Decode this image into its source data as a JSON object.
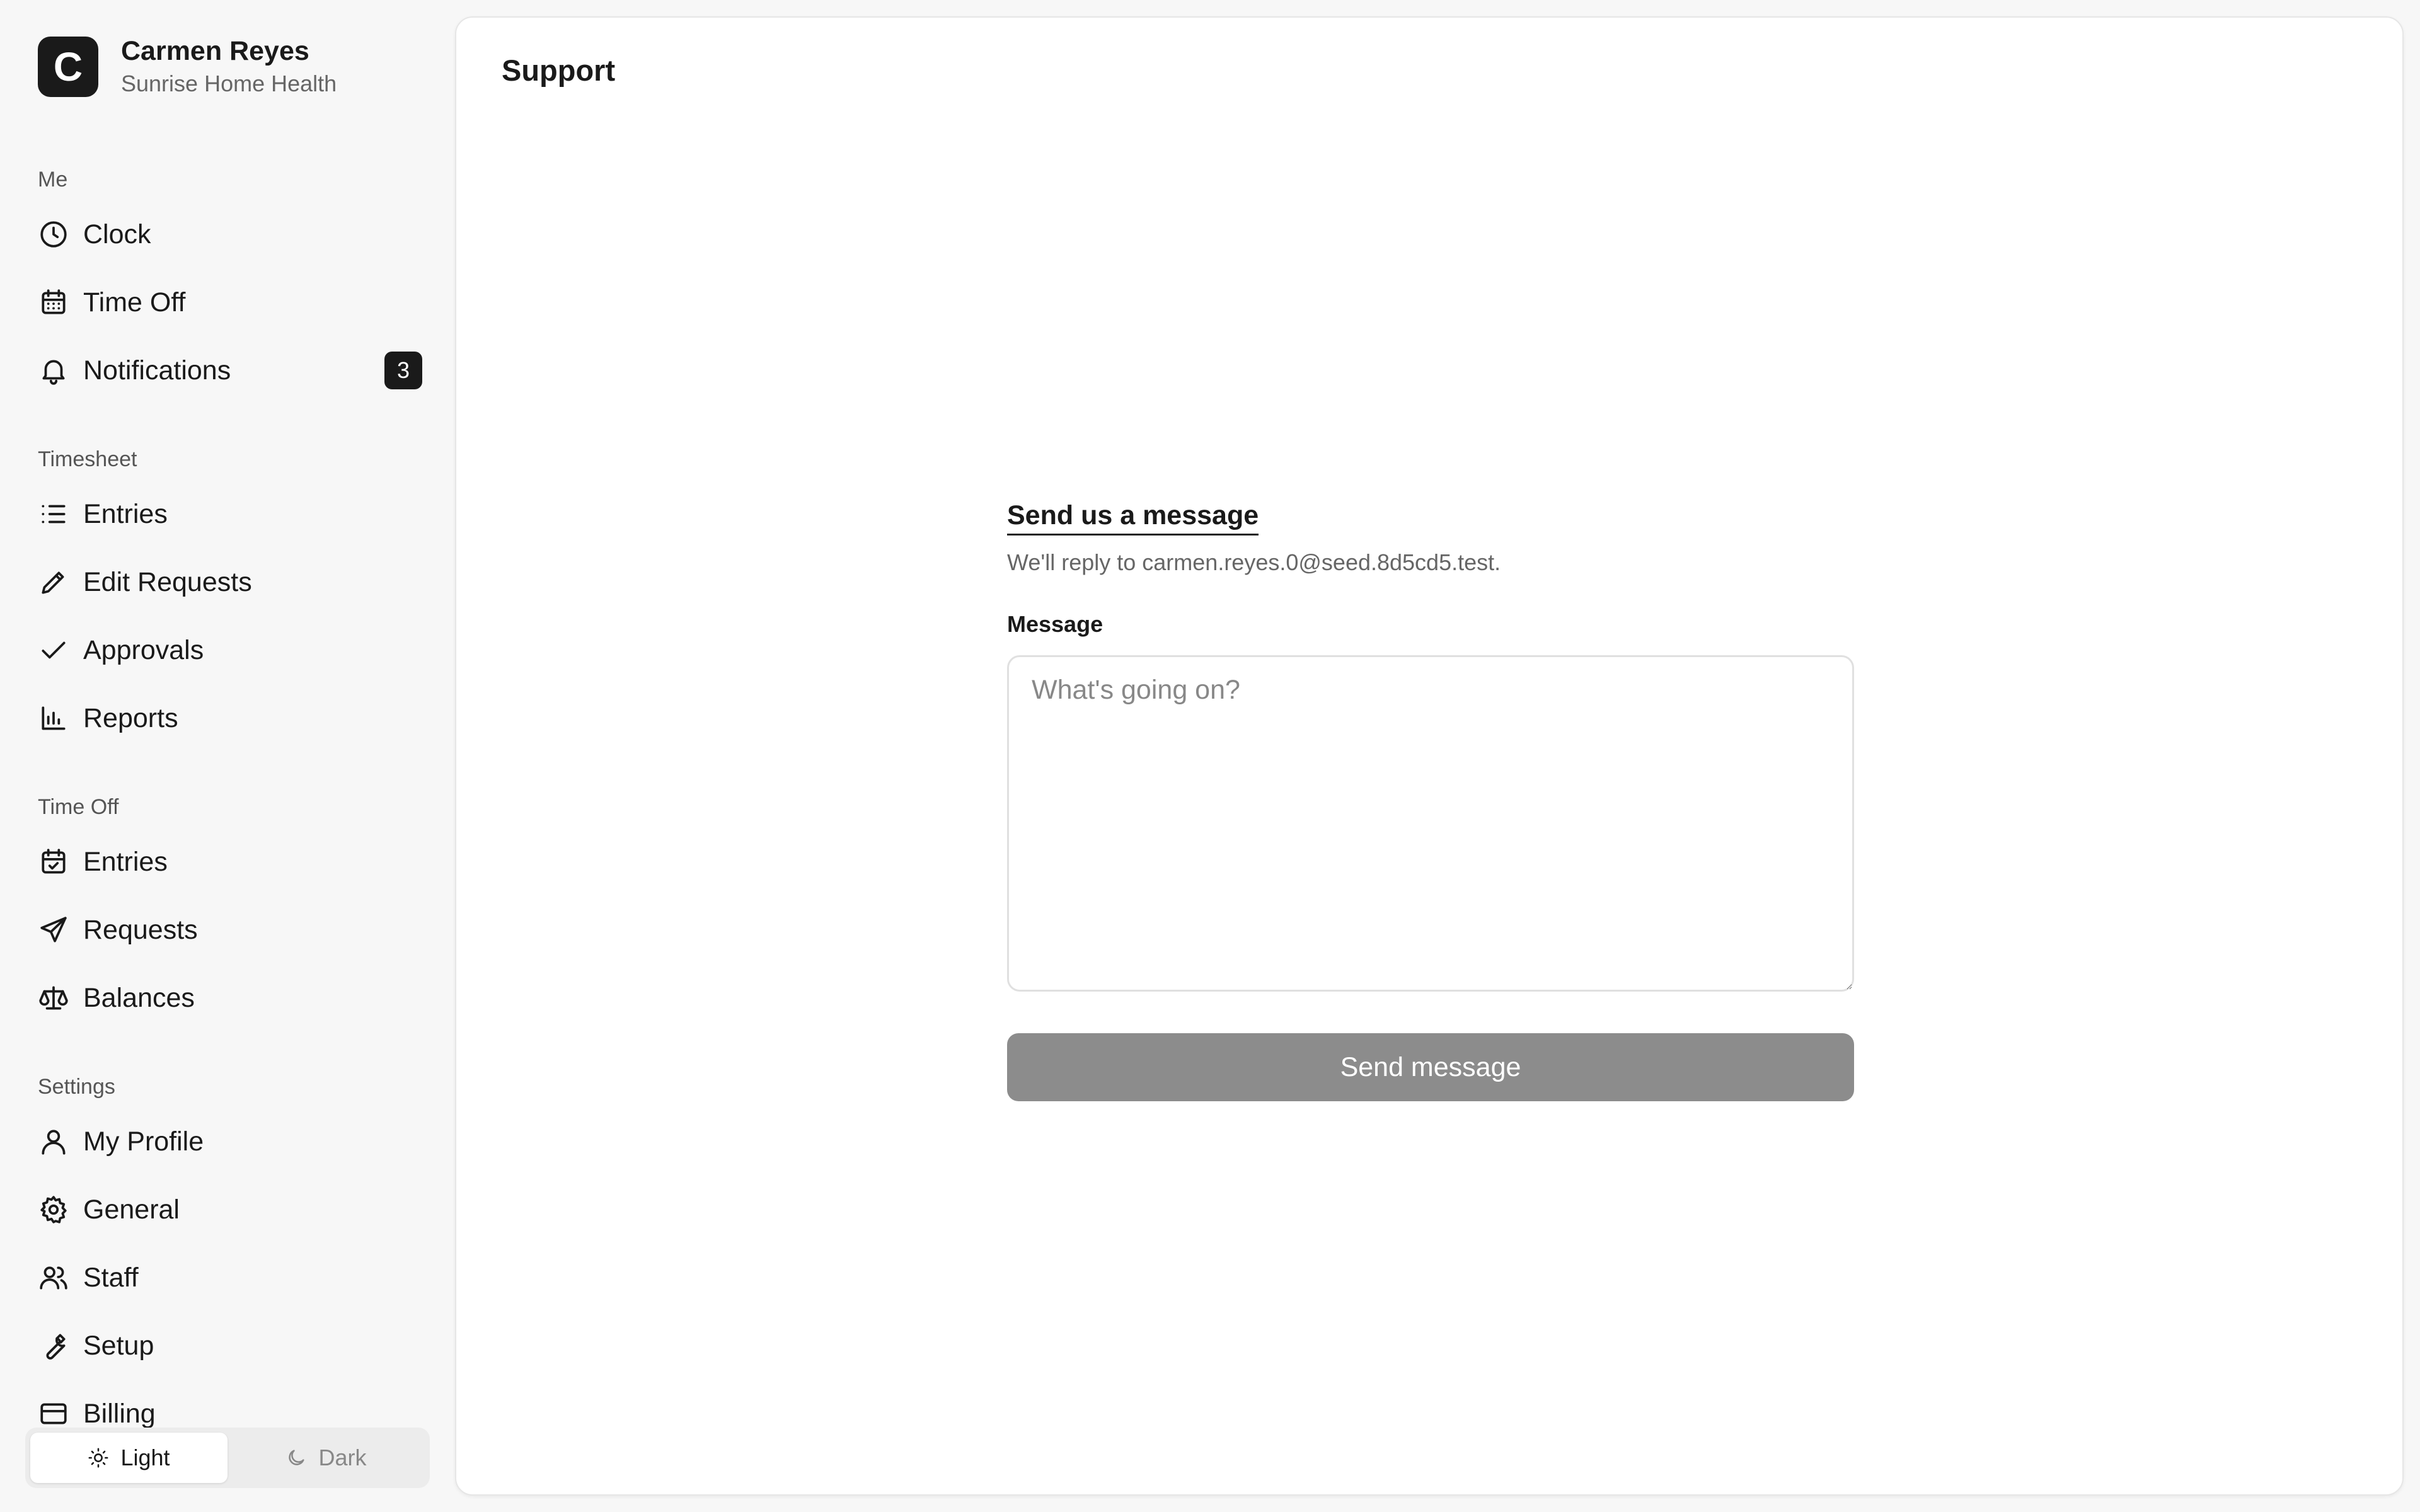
{
  "account": {
    "logo_letter": "C",
    "name": "Carmen Reyes",
    "org": "Sunrise Home Health"
  },
  "sections": {
    "me": "Me",
    "timesheet": "Timesheet",
    "time_off": "Time Off",
    "settings": "Settings"
  },
  "nav": {
    "clock": "Clock",
    "time_off": "Time Off",
    "notifications": "Notifications",
    "notifications_count": "3",
    "ts_entries": "Entries",
    "edit_requests": "Edit Requests",
    "approvals": "Approvals",
    "reports": "Reports",
    "to_entries": "Entries",
    "requests": "Requests",
    "balances": "Balances",
    "my_profile": "My Profile",
    "general": "General",
    "staff": "Staff",
    "setup": "Setup",
    "billing": "Billing"
  },
  "theme": {
    "light": "Light",
    "dark": "Dark",
    "selected": "Light"
  },
  "main": {
    "title": "Support",
    "form_title": "Send us a message",
    "form_subtitle": "We'll reply to carmen.reyes.0@seed.8d5cd5.test.",
    "message_label": "Message",
    "message_placeholder": "What's going on?",
    "message_value": "",
    "send_label": "Send message"
  }
}
